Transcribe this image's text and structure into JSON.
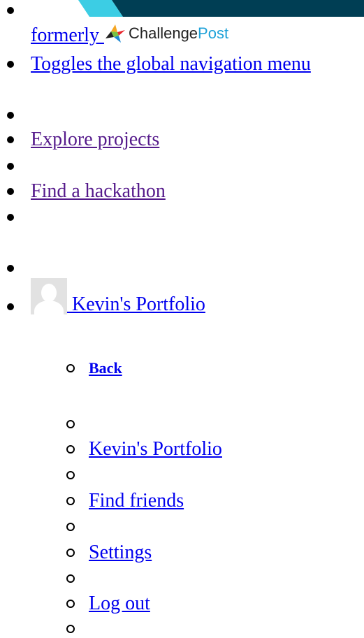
{
  "banner": {
    "left_color": "#3ccde4",
    "right_color": "#003e54"
  },
  "formerly": {
    "label": "formerly ",
    "brand_challenge": "Challenge",
    "brand_post": "Post"
  },
  "nav_toggle_label": "Toggles the global navigation menu",
  "nav": {
    "explore": "Explore projects",
    "hackathon": "Find a hackathon",
    "empty_link": " "
  },
  "user": {
    "portfolio_label": "Kevin's Portfolio"
  },
  "submenu": {
    "back": "Back",
    "portfolio": "Kevin's Portfolio",
    "find_friends": "Find friends",
    "settings": "Settings",
    "logout": "Log out"
  }
}
